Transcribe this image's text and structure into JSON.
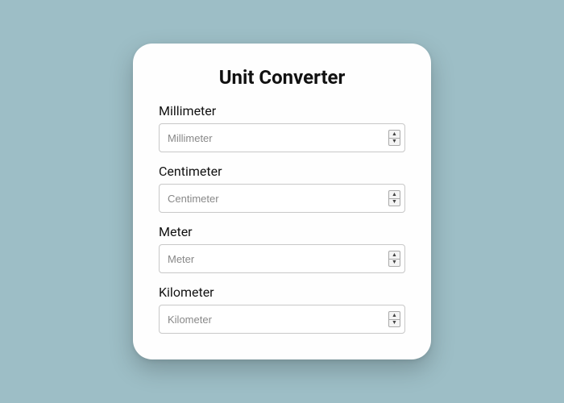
{
  "title": "Unit Converter",
  "fields": {
    "millimeter": {
      "label": "Millimeter",
      "placeholder": "Millimeter"
    },
    "centimeter": {
      "label": "Centimeter",
      "placeholder": "Centimeter"
    },
    "meter": {
      "label": "Meter",
      "placeholder": "Meter"
    },
    "kilometer": {
      "label": "Kilometer",
      "placeholder": "Kilometer"
    }
  }
}
